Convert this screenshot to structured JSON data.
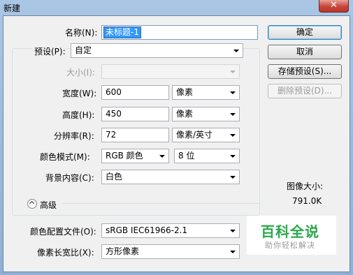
{
  "window": {
    "title": "新建",
    "close_label": "✕"
  },
  "form": {
    "name_label": "名称(N):",
    "name_value": "未标题-1",
    "preset_label": "预设(P):",
    "preset_value": "自定",
    "size_label": "大小(I):",
    "size_value": "",
    "width_label": "宽度(W):",
    "width_value": "600",
    "width_unit": "像素",
    "height_label": "高度(H):",
    "height_value": "450",
    "height_unit": "像素",
    "resolution_label": "分辨率(R):",
    "resolution_value": "72",
    "resolution_unit": "像素/英寸",
    "color_mode_label": "颜色模式(M):",
    "color_mode_value": "RGB 颜色",
    "bit_depth_value": "8 位",
    "background_label": "背景内容(C):",
    "background_value": "白色",
    "advanced_label": "高级",
    "color_profile_label": "颜色配置文件(O):",
    "color_profile_value": "sRGB IEC61966-2.1",
    "pixel_aspect_label": "像素长宽比(X):",
    "pixel_aspect_value": "方形像素"
  },
  "buttons": {
    "ok": "确定",
    "cancel": "取消",
    "save_preset": "存储预设(S)...",
    "delete_preset": "删除预设(D)..."
  },
  "image_size": {
    "label": "图像大小:",
    "value": "791.0K"
  },
  "watermark": {
    "text": "百科全说",
    "subtext": "助你轻松解决"
  },
  "colors": {
    "selection": "#3399ff",
    "watermark": "#2aa84a",
    "close_button": "#c8453a"
  }
}
